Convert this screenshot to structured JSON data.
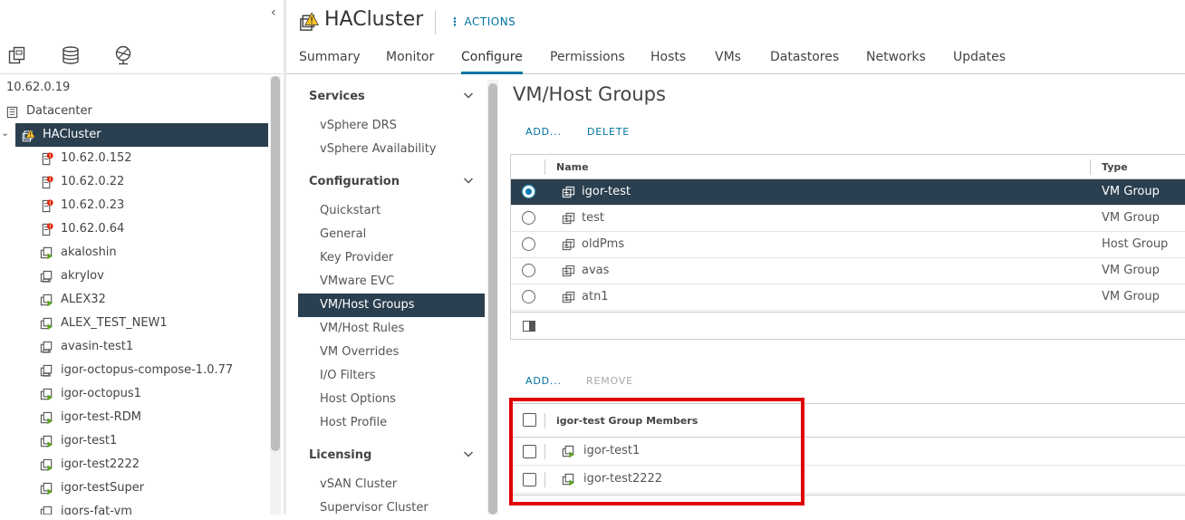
{
  "navigator": {
    "tabs": [
      {
        "icon": "hosts-clusters-icon"
      },
      {
        "icon": "storage-icon"
      },
      {
        "icon": "networking-icon"
      }
    ],
    "tree": [
      {
        "label": "10.62.0.19",
        "icon": "",
        "indent": 0
      },
      {
        "label": "Datacenter",
        "icon": "datacenter-icon",
        "indent": 1
      },
      {
        "label": "HACluster",
        "icon": "cluster-warning-icon",
        "indent": 2,
        "selected": true,
        "expanded": true
      },
      {
        "label": "10.62.0.152",
        "icon": "host-error-icon",
        "indent": 3
      },
      {
        "label": "10.62.0.22",
        "icon": "host-error-icon",
        "indent": 3
      },
      {
        "label": "10.62.0.23",
        "icon": "host-error-icon",
        "indent": 3
      },
      {
        "label": "10.62.0.64",
        "icon": "host-error-icon",
        "indent": 3
      },
      {
        "label": "akaloshin",
        "icon": "vm-on-icon",
        "indent": 3
      },
      {
        "label": "akrylov",
        "icon": "vm-off-icon",
        "indent": 3
      },
      {
        "label": "ALEX32",
        "icon": "vm-on-icon",
        "indent": 3
      },
      {
        "label": "ALEX_TEST_NEW1",
        "icon": "vm-on-icon",
        "indent": 3
      },
      {
        "label": "avasin-test1",
        "icon": "vm-off-icon",
        "indent": 3
      },
      {
        "label": "igor-octopus-compose-1.0.77",
        "icon": "vm-off-icon",
        "indent": 3
      },
      {
        "label": "igor-octopus1",
        "icon": "vm-on-icon",
        "indent": 3
      },
      {
        "label": "igor-test-RDM",
        "icon": "vm-on-icon",
        "indent": 3
      },
      {
        "label": "igor-test1",
        "icon": "vm-on-icon",
        "indent": 3
      },
      {
        "label": "igor-test2222",
        "icon": "vm-on-icon",
        "indent": 3
      },
      {
        "label": "igor-testSuper",
        "icon": "vm-on-icon",
        "indent": 3
      },
      {
        "label": "igors-fat-vm",
        "icon": "vm-off-icon",
        "indent": 3
      }
    ]
  },
  "header": {
    "title": "HACluster",
    "actions_label": "ACTIONS"
  },
  "tabs": [
    {
      "label": "Summary"
    },
    {
      "label": "Monitor"
    },
    {
      "label": "Configure",
      "active": true
    },
    {
      "label": "Permissions"
    },
    {
      "label": "Hosts"
    },
    {
      "label": "VMs"
    },
    {
      "label": "Datastores"
    },
    {
      "label": "Networks"
    },
    {
      "label": "Updates"
    }
  ],
  "configure_menu": [
    {
      "section": "Services",
      "items": [
        {
          "label": "vSphere DRS"
        },
        {
          "label": "vSphere Availability"
        }
      ]
    },
    {
      "section": "Configuration",
      "items": [
        {
          "label": "Quickstart"
        },
        {
          "label": "General"
        },
        {
          "label": "Key Provider"
        },
        {
          "label": "VMware EVC"
        },
        {
          "label": "VM/Host Groups",
          "selected": true
        },
        {
          "label": "VM/Host Rules"
        },
        {
          "label": "VM Overrides"
        },
        {
          "label": "I/O Filters"
        },
        {
          "label": "Host Options"
        },
        {
          "label": "Host Profile"
        }
      ]
    },
    {
      "section": "Licensing",
      "items": [
        {
          "label": "vSAN Cluster"
        },
        {
          "label": "Supervisor Cluster"
        }
      ]
    }
  ],
  "content": {
    "title": "VM/Host Groups",
    "groups_toolbar": {
      "add": "ADD...",
      "delete": "DELETE"
    },
    "groups_table": {
      "columns": [
        "Name",
        "Type"
      ],
      "rows": [
        {
          "name": "igor-test",
          "type": "VM Group",
          "selected": true
        },
        {
          "name": "test",
          "type": "VM Group"
        },
        {
          "name": "oldPms",
          "type": "Host Group"
        },
        {
          "name": "avas",
          "type": "VM Group"
        },
        {
          "name": "atn1",
          "type": "VM Group"
        }
      ]
    },
    "members_toolbar": {
      "add": "ADD...",
      "remove": "REMOVE"
    },
    "members_table": {
      "header": "igor-test Group Members",
      "rows": [
        {
          "name": "igor-test1"
        },
        {
          "name": "igor-test2222"
        }
      ]
    }
  },
  "colors": {
    "selection": "#2a3f4f",
    "accent": "#0072a3",
    "highlight_box": "#e00000"
  }
}
